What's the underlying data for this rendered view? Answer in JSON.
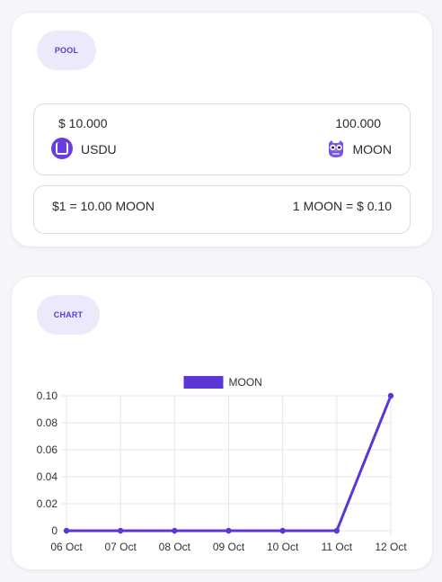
{
  "pool": {
    "label": "POOL",
    "token_a": {
      "amount": "$ 10.000",
      "symbol": "USDU",
      "icon": "usdu-token-icon"
    },
    "token_b": {
      "amount": "100.000",
      "symbol": "MOON",
      "icon": "moon-owl-icon"
    },
    "rate_a": "$1 = 10.00 MOON",
    "rate_b": "1 MOON = $ 0.10"
  },
  "chart": {
    "label": "CHART"
  },
  "colors": {
    "accent": "#5b35d5",
    "pill_bg": "#ece9fb",
    "grid": "#e6e6e6"
  },
  "chart_data": {
    "type": "line",
    "x": [
      "06 Oct",
      "07 Oct",
      "08 Oct",
      "09 Oct",
      "10 Oct",
      "11 Oct",
      "12 Oct"
    ],
    "series": [
      {
        "name": "MOON",
        "values": [
          0,
          0,
          0,
          0,
          0,
          0,
          0.1
        ],
        "color": "#5b35d5"
      }
    ],
    "y_ticks": [
      "0",
      "0.02",
      "0.04",
      "0.06",
      "0.08",
      "0.10"
    ],
    "ylim": [
      0,
      0.1
    ],
    "grid": true,
    "legend": "top-center"
  }
}
